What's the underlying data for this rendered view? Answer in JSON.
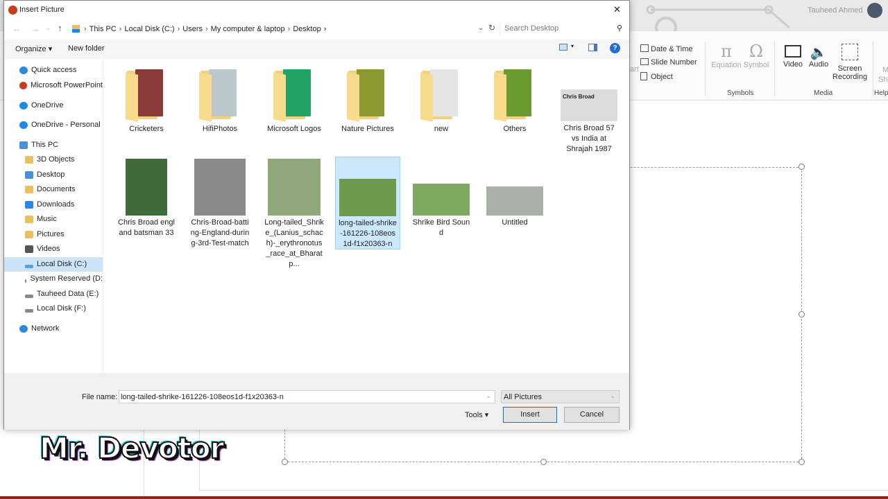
{
  "powerpoint": {
    "user_name": "Tauheed Ahmed",
    "ribbon": {
      "date_time": "Date & Time",
      "slide_number": "Slide Number",
      "object": "Object",
      "art_fragment": "art",
      "equation": "Equation",
      "symbol": "Symbol",
      "symbols_group": "Symbols",
      "video": "Video",
      "audio": "Audio",
      "screen_recording_1": "Screen",
      "screen_recording_2": "Recording",
      "media_group": "Media",
      "help_group": "Help",
      "cut_m": "M",
      "cut_sh": "Sh"
    },
    "watermark": "Mr. Devotor"
  },
  "dialog": {
    "title": "Insert Picture",
    "breadcrumb": [
      "This PC",
      "Local Disk (C:)",
      "Users",
      "My computer & laptop",
      "Desktop"
    ],
    "search_placeholder": "Search Desktop",
    "toolbar": {
      "organize": "Organize",
      "new_folder": "New folder",
      "help": "?"
    },
    "nav": [
      {
        "label": "Quick access",
        "icon": "star-icon",
        "color": "#2e86de"
      },
      {
        "label": "Microsoft PowerPoint",
        "icon": "powerpoint-icon",
        "color": "#c43e1c"
      },
      {
        "label": "OneDrive",
        "icon": "cloud-icon",
        "color": "#1e88e5"
      },
      {
        "label": "OneDrive - Personal",
        "icon": "cloud-icon",
        "color": "#1e88e5"
      },
      {
        "label": "This PC",
        "icon": "computer-icon",
        "color": "#4a90d9"
      },
      {
        "label": "3D Objects",
        "icon": "folder-icon",
        "color": "#e8c060"
      },
      {
        "label": "Desktop",
        "icon": "folder-icon",
        "color": "#4a90d9"
      },
      {
        "label": "Documents",
        "icon": "folder-icon",
        "color": "#e8c060"
      },
      {
        "label": "Downloads",
        "icon": "folder-icon",
        "color": "#2e86de"
      },
      {
        "label": "Music",
        "icon": "folder-icon",
        "color": "#e8c060"
      },
      {
        "label": "Pictures",
        "icon": "folder-icon",
        "color": "#e8c060"
      },
      {
        "label": "Videos",
        "icon": "folder-icon",
        "color": "#555"
      },
      {
        "label": "Local Disk (C:)",
        "icon": "drive-icon",
        "color": "#5aa0d8",
        "selected": true
      },
      {
        "label": "System Reserved (D:",
        "icon": "drive-icon",
        "color": "#888"
      },
      {
        "label": "Tauheed Data (E:)",
        "icon": "drive-icon",
        "color": "#888"
      },
      {
        "label": "Local Disk (F:)",
        "icon": "drive-icon",
        "color": "#888"
      },
      {
        "label": "Network",
        "icon": "network-icon",
        "color": "#2e86de"
      }
    ],
    "items": [
      {
        "label": "Cricketers",
        "type": "folder",
        "color": "#8b3a3a"
      },
      {
        "label": "HifiPhotos",
        "type": "folder",
        "color": "#bcc9cc"
      },
      {
        "label": "Microsoft Logos",
        "type": "folder",
        "color": "#21a366"
      },
      {
        "label": "Nature Pictures",
        "type": "folder",
        "color": "#8a9a30"
      },
      {
        "label": "new",
        "type": "folder",
        "color": "#e4e4e4"
      },
      {
        "label": "Others",
        "type": "folder",
        "color": "#6a9a30"
      },
      {
        "label": "Chris Broad 57 vs India at Shrajah 1987",
        "type": "image",
        "color": "#dcdcdc",
        "thumb_text": "Chris Broad"
      },
      {
        "label": "Chris Broad england batsman 33",
        "type": "image",
        "color": "#3f6b3a"
      },
      {
        "label": "Chris-Broad-batting-England-during-3rd-Test-match",
        "type": "image",
        "color": "#8a8a8a"
      },
      {
        "label": "Long-tailed_Shrike_(Lanius_schach)-_erythronotus_race_at_Bharatp...",
        "type": "image",
        "color": "#8fa77a"
      },
      {
        "label": "long-tailed-shrike-161226-108eos1d-f1x20363-n",
        "type": "image",
        "color": "#6e9a4e",
        "selected": true
      },
      {
        "label": "Shrike Bird Sound",
        "type": "image",
        "color": "#7fa860"
      },
      {
        "label": "Untitled",
        "type": "image",
        "color": "#a9b0a8"
      }
    ],
    "file_name_label": "File name:",
    "file_name_value": "long-tailed-shrike-161226-108eos1d-f1x20363-n",
    "file_type": "All Pictures",
    "tools": "Tools",
    "insert": "Insert",
    "cancel": "Cancel",
    "close": "✕"
  }
}
